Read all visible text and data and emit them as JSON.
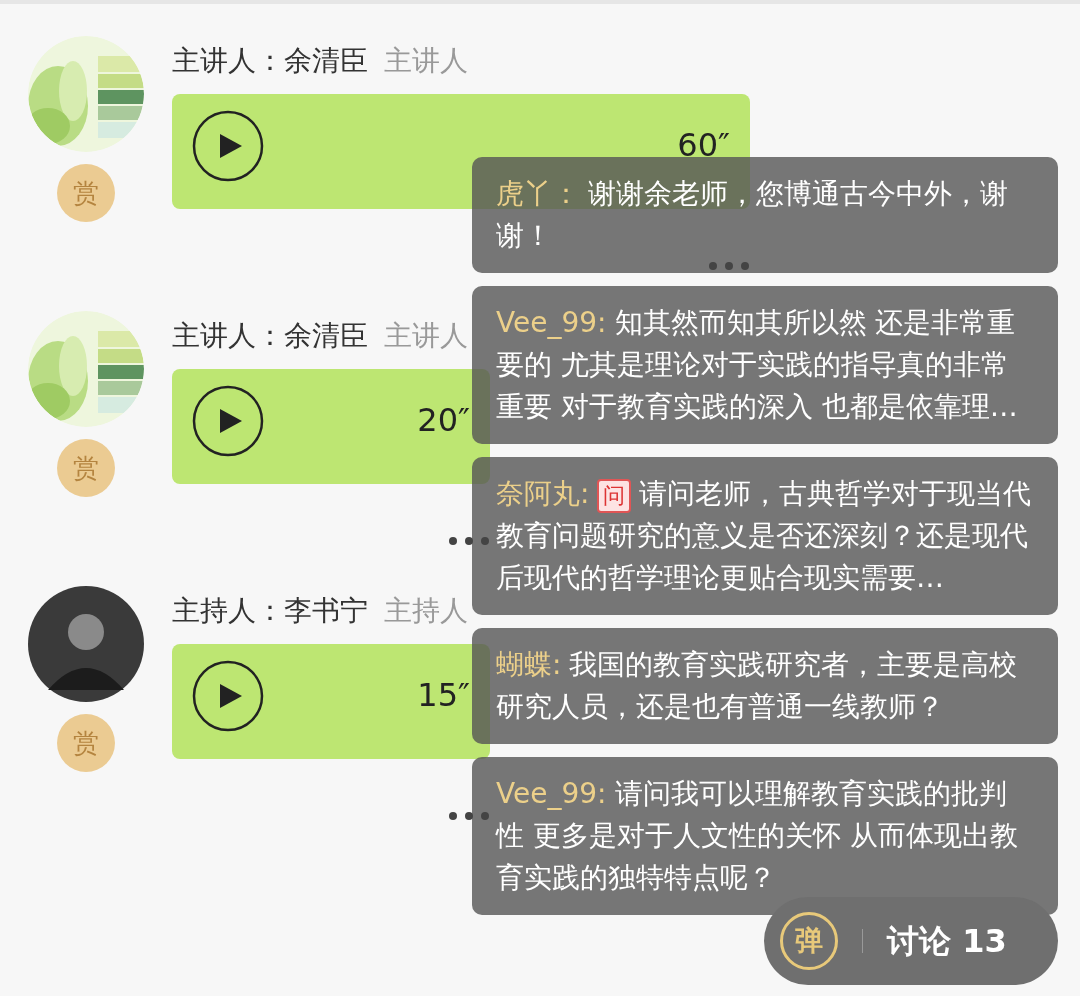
{
  "messages": [
    {
      "reward": "赏",
      "speaker": "主讲人：余清臣",
      "role": "主讲人",
      "voice": {
        "duration": "60″"
      }
    },
    {
      "reward": "赏",
      "speaker": "主讲人：余清臣",
      "role": "主讲人",
      "voice": {
        "duration": "20″"
      }
    },
    {
      "avatar": {
        "kind": "person"
      },
      "reward": "赏",
      "speaker": "主持人：李书宁",
      "role": "主持人",
      "voice": {
        "duration": "15″"
      }
    }
  ],
  "comments": [
    {
      "author": "虎丫：",
      "text": "谢谢余老师，您博通古今中外，谢谢！"
    },
    {
      "author": "Vee_99:",
      "text": "知其然而知其所以然 还是非常重要的 尤其是理论对于实践的指导真的非常重要 对于教育实践的深入 也都是依靠理…"
    },
    {
      "author": "奈阿丸:",
      "badge": "问",
      "text": "请问老师，古典哲学对于现当代教育问题研究的意义是否还深刻？还是现代后现代的哲学理论更贴合现实需要…"
    },
    {
      "author": "蝴蝶:",
      "text": "我国的教育实践研究者，主要是高校研究人员，还是也有普通一线教师？"
    },
    {
      "author": "Vee_99:",
      "text": "请问我可以理解教育实践的批判性 更多是对于人文性的关怀 从而体现出教育实践的独特特点呢？"
    }
  ],
  "discussion": {
    "danmaku": "弹",
    "label": "讨论 13"
  }
}
